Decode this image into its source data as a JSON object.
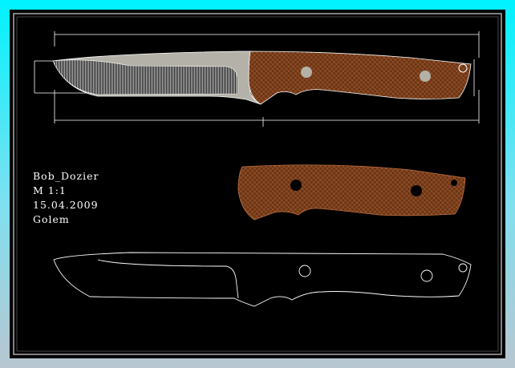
{
  "title_block": {
    "designer": "Bob_Dozier",
    "scale": "M 1:1",
    "date": "15.04.2009",
    "author": "Golem"
  },
  "colors": {
    "background": "#000000",
    "line": "#ffffff",
    "blade": "#b4b2a8",
    "handle": "#7a3a14"
  }
}
